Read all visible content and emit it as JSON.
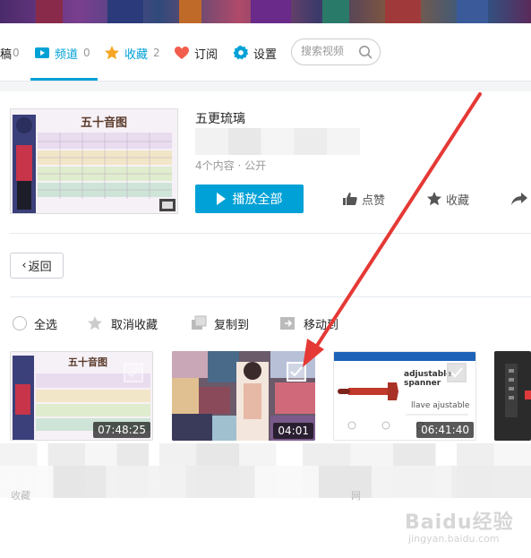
{
  "nav": {
    "items": [
      {
        "label": "稿",
        "count": "0",
        "icon": "upload-icon"
      },
      {
        "label": "频道",
        "count": "0",
        "icon": "channel-icon"
      },
      {
        "label": "收藏",
        "count": "2",
        "icon": "star-icon"
      },
      {
        "label": "订阅",
        "count": "",
        "icon": "heart-icon"
      },
      {
        "label": "设置",
        "count": "",
        "icon": "gear-icon"
      }
    ],
    "active_color": "#00a1d6",
    "search_placeholder": "搜索视频"
  },
  "favorite": {
    "title": "五更琉璃",
    "meta": "4个内容 · 公开",
    "thumb_heading": "五十音图",
    "play_all_label": "播放全部",
    "like_label": "点赞",
    "collect_label": "收藏"
  },
  "back_label": "返回",
  "bulk": {
    "select_all": "全选",
    "unfavorite": "取消收藏",
    "copy_to": "复制到",
    "move_to": "移动到"
  },
  "videos": [
    {
      "duration": "07:48:25",
      "thumb_heading": "五十音图"
    },
    {
      "duration": "04:01"
    },
    {
      "duration": "06:41:40",
      "thumb_title": "adjustable spanner",
      "thumb_sub": "llave ajustable"
    },
    {
      "duration": ""
    }
  ],
  "footer_fragments": [
    "收藏",
    "网"
  ],
  "watermark": {
    "main": "Baidu经验",
    "sub": "jingyan.baidu.com"
  }
}
